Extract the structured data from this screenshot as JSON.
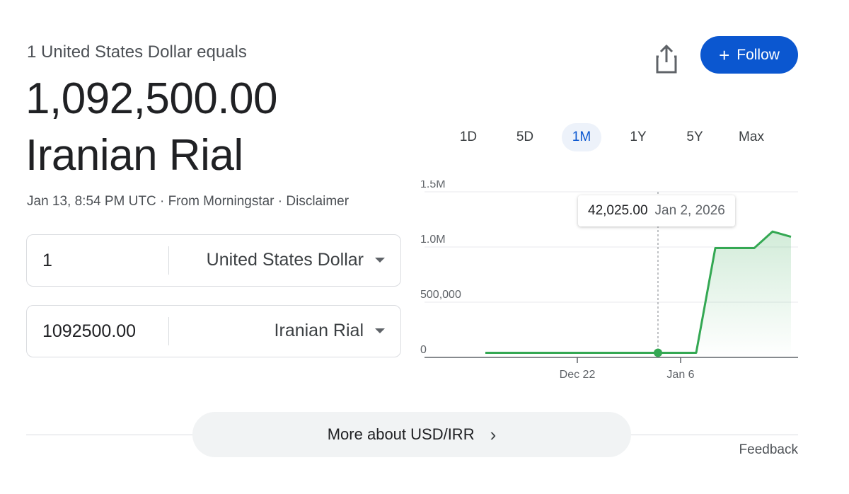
{
  "header": {
    "subtitle": "1 United States Dollar equals",
    "amount": "1,092,500.00",
    "currency_name": "Iranian Rial",
    "meta": "Jan 13, 8:54 PM UTC · From Morningstar · Disclaimer"
  },
  "actions": {
    "follow_label": "Follow",
    "follow_plus": "+"
  },
  "converter": {
    "from": {
      "value": "1",
      "unit": "United States Dollar"
    },
    "to": {
      "value": "1092500.00",
      "unit": "Iranian Rial"
    }
  },
  "range_tabs": [
    "1D",
    "5D",
    "1M",
    "1Y",
    "5Y",
    "Max"
  ],
  "active_range": "1M",
  "tooltip": {
    "value": "42,025.00",
    "date": "Jan 2, 2026"
  },
  "footer": {
    "more_label": "More about USD/IRR",
    "feedback_label": "Feedback"
  },
  "colors": {
    "accent": "#0b57d0",
    "line": "#34a853",
    "active_tab_bg": "#edf2fa"
  },
  "chart_data": {
    "type": "area",
    "y_ticks": [
      "1.5M",
      "1.0M",
      "500,000",
      "0"
    ],
    "y_tick_values": [
      1500000,
      1000000,
      500000,
      0
    ],
    "x_ticks": [
      "Dec 22",
      "Jan 6"
    ],
    "ylim": [
      0,
      1500000
    ],
    "series": [
      {
        "x_index": [
          0,
          1,
          2,
          3,
          4,
          5,
          6,
          7,
          8,
          9
        ],
        "values": [
          42025,
          42025,
          42025,
          42025,
          42025,
          42025,
          990000,
          990000,
          1140000,
          1092500
        ]
      }
    ],
    "highlight_index": 4,
    "grid": true
  }
}
